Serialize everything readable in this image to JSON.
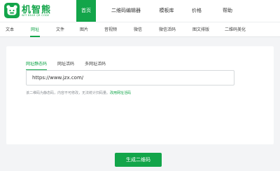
{
  "brand": {
    "name": "机智熊",
    "subtitle": "WIT BEAR QR CODE",
    "color": "#13a54a"
  },
  "nav": {
    "items": [
      {
        "label": "首页",
        "active": true
      },
      {
        "label": "二维码编辑器",
        "active": false
      },
      {
        "label": "模板库",
        "active": false
      },
      {
        "label": "价格",
        "active": false
      },
      {
        "label": "帮助",
        "active": false
      }
    ]
  },
  "tabs": {
    "items": [
      {
        "label": "文本",
        "active": false
      },
      {
        "label": "网址",
        "active": true
      },
      {
        "label": "文件",
        "active": false
      },
      {
        "label": "图片",
        "active": false
      },
      {
        "label": "音视频",
        "active": false
      },
      {
        "label": "微信",
        "active": false
      },
      {
        "label": "微信活码",
        "active": false
      },
      {
        "label": "图文排版",
        "active": false
      },
      {
        "label": "二维码美化",
        "active": false
      }
    ]
  },
  "form": {
    "subtabs": [
      {
        "label": "网址静态码",
        "active": true
      },
      {
        "label": "网址活码",
        "active": false
      },
      {
        "label": "多网址活码",
        "active": false
      }
    ],
    "url_value": "https://www.jzx.com/",
    "note_text": "该二维码为静态码，内容不可修改，无法统计扫码量。",
    "note_link": "改用网址活码"
  },
  "actions": {
    "generate_label": "生成二维码"
  }
}
